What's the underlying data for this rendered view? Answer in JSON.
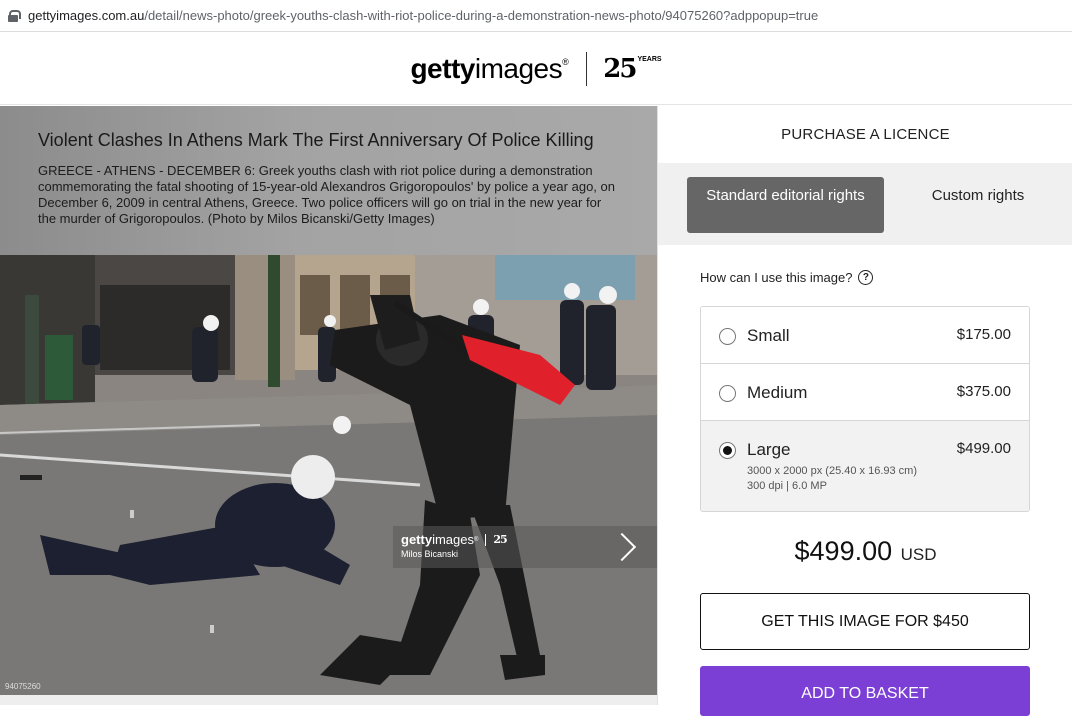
{
  "browser": {
    "url_host": "gettyimages.com.au",
    "url_path": "/detail/news-photo/greek-youths-clash-with-riot-police-during-a-demonstration-news-photo/94075260?adppopup=true"
  },
  "header": {
    "logo_bold": "getty",
    "logo_light": "images",
    "logo_mark": "®",
    "anniversary_number": "25",
    "anniversary_word": "YEARS"
  },
  "caption": {
    "title": "Violent Clashes In Athens Mark The First Anniversary Of Police Killing",
    "body": "GREECE - ATHENS - DECEMBER 6: Greek youths clash with riot police during a demonstration commemorating the fatal shooting of 15-year-old Alexandros Grigoropoulos' by police a year ago, on December 6, 2009 in central Athens, Greece. Two police officers will go on trial in the new year for the murder of Grigoropoulos. (Photo by Milos Bicanski/Getty Images)"
  },
  "watermark": {
    "logo_bold": "getty",
    "logo_light": "images",
    "mark": "®",
    "number": "25",
    "credit": "Milos Bicanski",
    "image_id": "94075260"
  },
  "panel": {
    "title": "PURCHASE A LICENCE",
    "tabs": [
      {
        "label": "Standard editorial rights",
        "active": true
      },
      {
        "label": "Custom rights",
        "active": false
      }
    ],
    "how_use": "How can I use this image?",
    "help_icon": "?",
    "sizes": [
      {
        "name": "Small",
        "price": "$175.00",
        "selected": false
      },
      {
        "name": "Medium",
        "price": "$375.00",
        "selected": false
      },
      {
        "name": "Large",
        "price": "$499.00",
        "selected": true,
        "dimensions": "3000 x 2000 px (25.40 x 16.93 cm)",
        "resolution": "300 dpi | 6.0 MP"
      }
    ],
    "total_amount": "$499.00",
    "total_currency": "USD",
    "get_image_label": "GET THIS IMAGE FOR $450",
    "add_basket_label": "ADD TO BASKET"
  },
  "colors": {
    "accent_purple": "#7b3fd6",
    "active_tab": "#666666",
    "flag_red": "#e0202a"
  }
}
